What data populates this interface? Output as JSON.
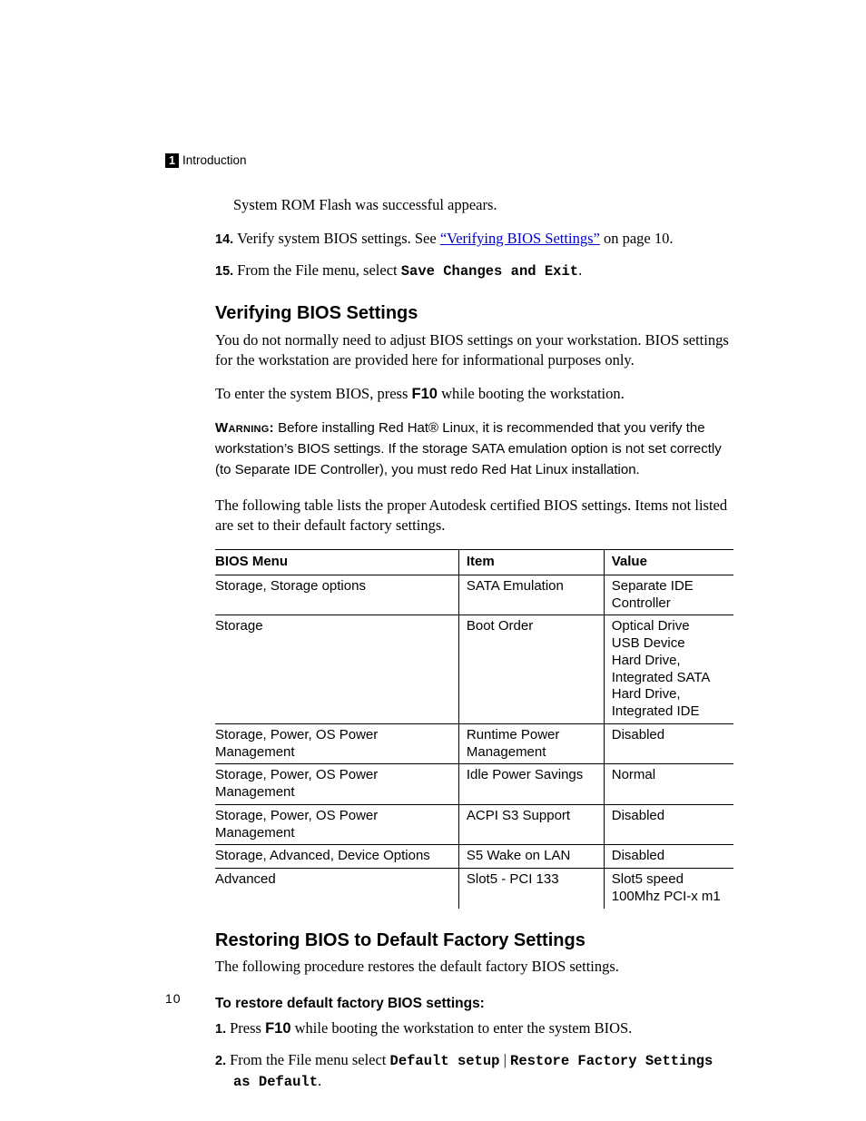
{
  "runningHead": {
    "chapterNum": "1",
    "chapterTitle": "Introduction"
  },
  "intro": {
    "topPara": "System ROM Flash was successful appears.",
    "steps": [
      {
        "num": "14.",
        "pre": "Verify system BIOS settings. See ",
        "link": "“Verifying BIOS Settings”",
        "post": " on page 10."
      },
      {
        "num": "15.",
        "pre": "From the File menu, select ",
        "mono": "Save Changes and Exit",
        "post": "."
      }
    ]
  },
  "verify": {
    "heading": "Verifying BIOS Settings",
    "p1": "You do not normally need to adjust BIOS settings on your workstation. BIOS settings for the workstation are provided here for informational purposes only.",
    "p2a": "To enter the system BIOS, press ",
    "p2b": "F10",
    "p2c": " while booting the workstation.",
    "warnLead": "Warning:",
    "warnBody": " Before installing Red Hat® Linux, it is recommended that you verify the workstation’s BIOS settings. If the storage SATA emulation option is not set correctly (to Separate IDE Controller), you must redo Red Hat Linux installation.",
    "p3": "The following table lists the proper Autodesk certified BIOS settings. Items not listed are set to their default factory settings."
  },
  "table": {
    "headers": [
      "BIOS Menu",
      "Item",
      "Value"
    ],
    "rows": [
      [
        "Storage, Storage options",
        "SATA Emulation",
        "Separate IDE Controller"
      ],
      [
        "Storage",
        "Boot Order",
        "Optical Drive\nUSB Device\nHard Drive, Integrated SATA\nHard Drive, Integrated IDE"
      ],
      [
        "Storage, Power, OS Power Management",
        "Runtime Power Management",
        "Disabled"
      ],
      [
        "Storage, Power, OS Power Management",
        "Idle Power Savings",
        "Normal"
      ],
      [
        "Storage, Power, OS Power Management",
        "ACPI S3 Support",
        "Disabled"
      ],
      [
        "Storage, Advanced, Device Options",
        "S5 Wake on LAN",
        "Disabled"
      ],
      [
        "Advanced",
        "Slot5 - PCI 133",
        "Slot5 speed 100Mhz PCI-x m1"
      ]
    ]
  },
  "restore": {
    "heading": "Restoring BIOS to Default Factory Settings",
    "p1": "The following procedure restores the default factory BIOS settings.",
    "subhead": "To restore default factory BIOS settings:",
    "steps": [
      {
        "num": "1.",
        "parts": [
          {
            "t": "Press "
          },
          {
            "t": "F10",
            "cls": "bold-sans"
          },
          {
            "t": " while booting the workstation to enter the system BIOS."
          }
        ]
      },
      {
        "num": "2.",
        "parts": [
          {
            "t": "From the File menu select "
          },
          {
            "t": "Default setup",
            "cls": "mono-bold"
          },
          {
            "t": " | "
          },
          {
            "t": "Restore Factory Settings as Default",
            "cls": "mono-bold"
          },
          {
            "t": "."
          }
        ]
      }
    ]
  },
  "pageNumber": "10"
}
